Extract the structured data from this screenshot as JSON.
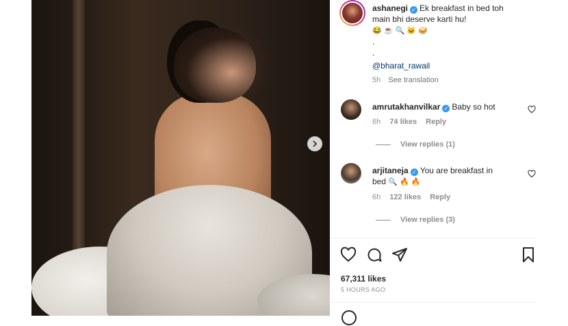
{
  "post": {
    "author": "ashanegi",
    "caption_line1": "Ek breakfast in bed toh",
    "caption_line2": "main bhi deserve karti hu!",
    "caption_emojis": "😂 ☕ 🔍 🐱 🥪",
    "dot1": ".",
    "dot2": ".",
    "mention": "@bharat_rawail",
    "time": "5h",
    "see_translation": "See translation",
    "likes": "67,311 likes",
    "posted_ago": "5 HOURS AGO"
  },
  "comments": [
    {
      "user": "amrutakhanvilkar",
      "text": "Baby so hot",
      "time": "6h",
      "likes": "74 likes",
      "reply": "Reply",
      "view_replies": "View replies (1)"
    },
    {
      "user": "arjitaneja",
      "text_line1": "You are breakfast in",
      "text_line2": "bed",
      "emojis": "🔍 🔥 🔥",
      "time": "6h",
      "likes": "122 likes",
      "reply": "Reply",
      "view_replies": "View replies (3)"
    }
  ],
  "icons": {
    "verified": "verified-badge-icon",
    "like": "heart-icon",
    "comment": "comment-icon",
    "share": "paper-plane-icon",
    "save": "bookmark-icon",
    "next": "chevron-right-icon"
  },
  "colors": {
    "verified": "#3897f0",
    "link": "#00376b",
    "muted": "#8e8e8e"
  }
}
